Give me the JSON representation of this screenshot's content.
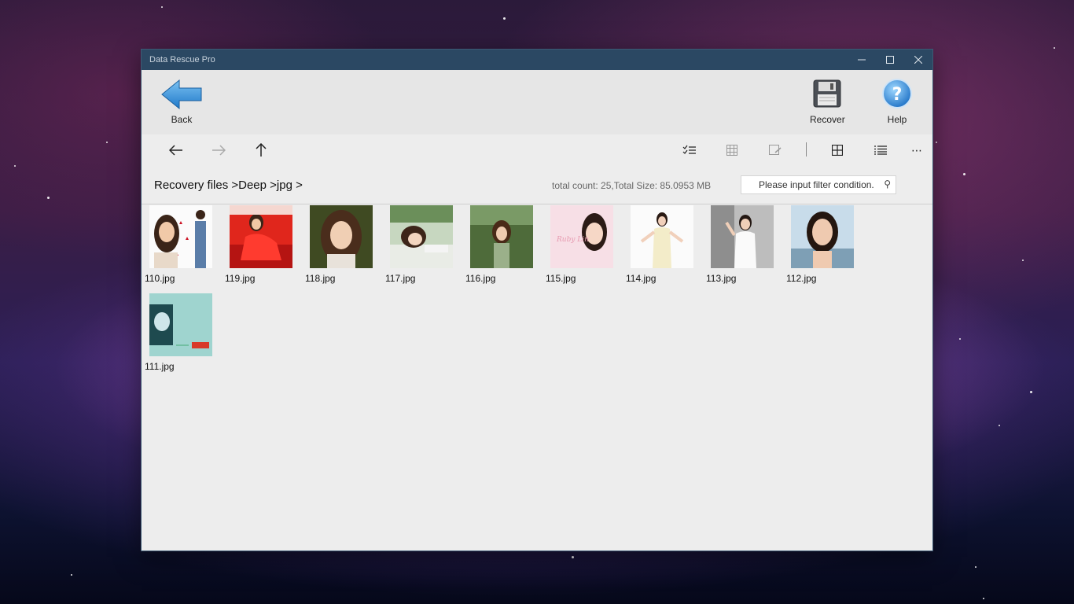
{
  "window": {
    "title": "Data Rescue Pro"
  },
  "ribbon": {
    "back_label": "Back",
    "recover_label": "Recover",
    "help_label": "Help"
  },
  "breadcrumb": "Recovery files >Deep >jpg >",
  "totals": "total count: 25,Total Size: 85.0953 MB",
  "filter": {
    "placeholder": "Please input filter condition."
  },
  "files": [
    {
      "name": "110.jpg"
    },
    {
      "name": "119.jpg"
    },
    {
      "name": "118.jpg"
    },
    {
      "name": "117.jpg"
    },
    {
      "name": "116.jpg"
    },
    {
      "name": "115.jpg"
    },
    {
      "name": "114.jpg"
    },
    {
      "name": "113.jpg"
    },
    {
      "name": "112.jpg"
    },
    {
      "name": "111.jpg"
    }
  ],
  "colors": {
    "titlebar": "#2b4863",
    "accent": "#1e8be0"
  }
}
